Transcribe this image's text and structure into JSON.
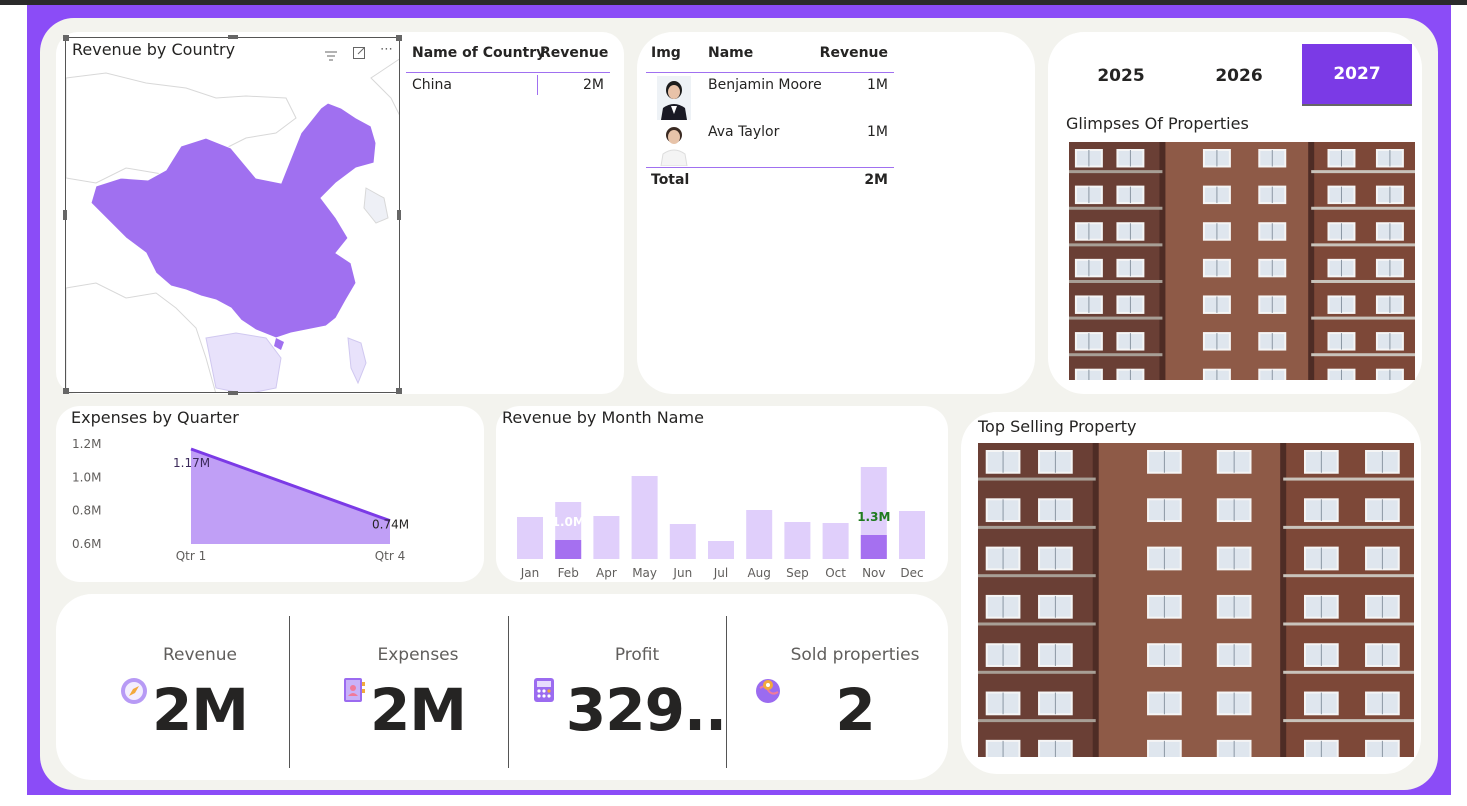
{
  "map_card": {
    "title": "Revenue by Country",
    "highlight_color": "#a070f0"
  },
  "country_table": {
    "headers": [
      "Name of Country",
      "Revenue"
    ],
    "rows": [
      [
        "China",
        "2M"
      ]
    ]
  },
  "agent_table": {
    "headers": [
      "Img",
      "Name",
      "Revenue"
    ],
    "rows": [
      {
        "name": "Benjamin Moore",
        "revenue": "1M"
      },
      {
        "name": "Ava Taylor",
        "revenue": "1M"
      }
    ],
    "total_label": "Total",
    "total_value": "2M"
  },
  "years": {
    "items": [
      "2025",
      "2026",
      "2027"
    ],
    "active": "2027"
  },
  "glimpses": {
    "title": "Glimpses Of Properties"
  },
  "top_selling": {
    "title": "Top Selling Property"
  },
  "expenses_chart": {
    "title": "Expenses by Quarter",
    "chart_data": {
      "type": "area",
      "categories": [
        "Qtr 1",
        "Qtr 4"
      ],
      "values": [
        1.17,
        0.74
      ],
      "data_labels": [
        "1.17M",
        "0.74M"
      ],
      "y_ticks": [
        "1.2M",
        "1.0M",
        "0.8M",
        "0.6M"
      ],
      "ylim": [
        0.6,
        1.2
      ],
      "color": "#9b6bf0"
    }
  },
  "revenue_chart": {
    "title": "Revenue by Month Name",
    "chart_data": {
      "type": "bar",
      "categories": [
        "Jan",
        "Feb",
        "Apr",
        "May",
        "Jun",
        "Jul",
        "Aug",
        "Sep",
        "Oct",
        "Nov",
        "Dec"
      ],
      "values": [
        0.42,
        0.57,
        0.43,
        0.83,
        0.35,
        0.18,
        0.49,
        0.37,
        0.36,
        0.92,
        0.48
      ],
      "highlight": [
        0,
        0.19,
        0,
        0,
        0,
        0,
        0,
        0,
        0,
        0.24,
        0
      ],
      "labels": [
        "",
        "1.0M",
        "",
        "",
        "",
        "",
        "",
        "",
        "",
        "1.3M",
        ""
      ],
      "bar_color": "#e0cffb",
      "highlight_color": "#a570f0",
      "label_color": "#1f7a1f"
    }
  },
  "kpis": [
    {
      "label": "Revenue",
      "value": "2M",
      "icon": "compass-icon"
    },
    {
      "label": "Expenses",
      "value": "2M",
      "icon": "contact-book-icon"
    },
    {
      "label": "Profit",
      "value": "329..",
      "icon": "calculator-icon"
    },
    {
      "label": "Sold properties",
      "value": "2",
      "icon": "map-pin-globe-icon"
    }
  ]
}
